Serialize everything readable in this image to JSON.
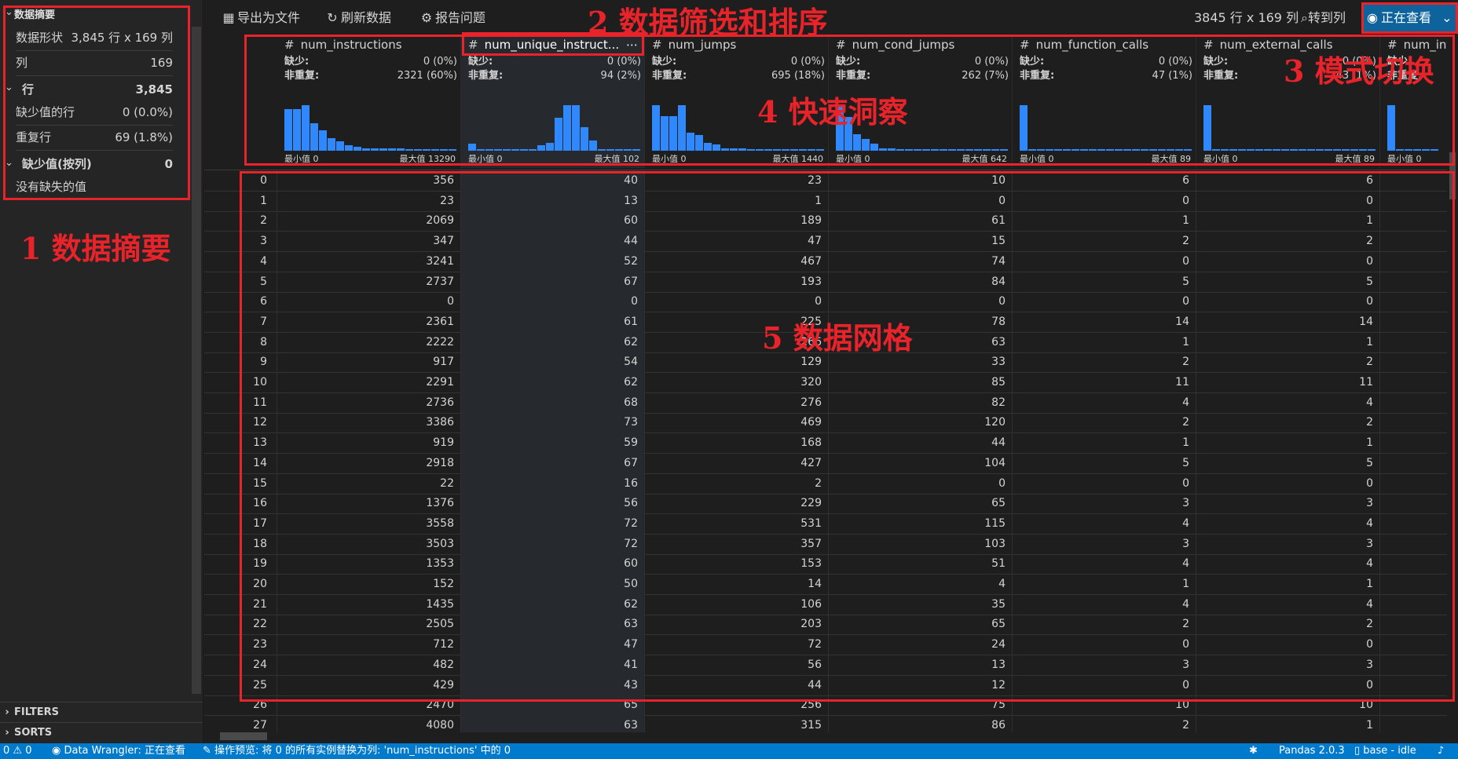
{
  "sidebar": {
    "title": "数据摘要",
    "shape_label": "数据形状",
    "shape_value": "3,845 行 x 169 列",
    "cols_label": "列",
    "cols_value": "169",
    "rows_label": "行",
    "rows_value": "3,845",
    "missing_rows_label": "缺少值的行",
    "missing_rows_value": "0 (0.0%)",
    "dup_rows_label": "重复行",
    "dup_rows_value": "69 (1.8%)",
    "missing_by_col_label": "缺少值(按列)",
    "missing_by_col_value": "0",
    "no_missing_text": "没有缺失的值",
    "filters_label": "FILTERS",
    "sorts_label": "SORTS"
  },
  "toolbar": {
    "export_label": "导出为文件",
    "refresh_label": "刷新数据",
    "report_label": "报告问题",
    "shape_text": "3845 行 x 169 列",
    "goto_label": "转到列",
    "mode_label": "正在查看"
  },
  "header_labels": {
    "missing": "缺少:",
    "distinct": "非重复:",
    "min_prefix": "最小值",
    "max_prefix": "最大值"
  },
  "columns": [
    {
      "name": "num_instructions",
      "missing": "0 (0%)",
      "distinct": "2321 (60%)",
      "min": "0",
      "max": "13290",
      "hist": [
        0.92,
        0.92,
        1.0,
        0.6,
        0.44,
        0.28,
        0.2,
        0.12,
        0.08,
        0.06,
        0.05,
        0.05,
        0.05,
        0.05,
        0.04,
        0.04,
        0.04,
        0.04,
        0.04,
        0.04
      ]
    },
    {
      "name": "num_unique_instruct...",
      "missing": "0 (0%)",
      "distinct": "94 (2%)",
      "min": "0",
      "max": "102",
      "hist": [
        0.16,
        0.04,
        0.04,
        0.04,
        0.04,
        0.04,
        0.04,
        0.04,
        0.12,
        0.18,
        0.72,
        1.0,
        1.0,
        0.52,
        0.22,
        0.04,
        0.04,
        0.04,
        0.04,
        0.04
      ]
    },
    {
      "name": "num_jumps",
      "missing": "0 (0%)",
      "distinct": "695 (18%)",
      "min": "0",
      "max": "1440",
      "hist": [
        1.0,
        0.76,
        0.76,
        1.0,
        0.4,
        0.34,
        0.18,
        0.14,
        0.06,
        0.05,
        0.05,
        0.04,
        0.04,
        0.04,
        0.04,
        0.04,
        0.04,
        0.04,
        0.04,
        0.04
      ]
    },
    {
      "name": "num_cond_jumps",
      "missing": "0 (0%)",
      "distinct": "262 (7%)",
      "min": "0",
      "max": "642",
      "hist": [
        1.0,
        0.74,
        0.36,
        0.26,
        0.16,
        0.06,
        0.05,
        0.04,
        0.04,
        0.04,
        0.04,
        0.04,
        0.04,
        0.04,
        0.04,
        0.04,
        0.04,
        0.04,
        0.04,
        0.04
      ]
    },
    {
      "name": "num_function_calls",
      "missing": "0 (0%)",
      "distinct": "47 (1%)",
      "min": "0",
      "max": "89",
      "hist": [
        1.0,
        0.04,
        0.04,
        0.04,
        0.04,
        0.04,
        0.04,
        0.04,
        0.04,
        0.04,
        0.04,
        0.04,
        0.04,
        0.04,
        0.04,
        0.04,
        0.04,
        0.04,
        0.04,
        0.04
      ]
    },
    {
      "name": "num_external_calls",
      "missing": "0 (0%)",
      "distinct": "43 (1%)",
      "min": "0",
      "max": "89",
      "hist": [
        1.0,
        0.04,
        0.04,
        0.04,
        0.04,
        0.04,
        0.04,
        0.04,
        0.04,
        0.04,
        0.04,
        0.04,
        0.04,
        0.04,
        0.04,
        0.04,
        0.04,
        0.04,
        0.04,
        0.04
      ]
    },
    {
      "name": "num_int",
      "missing": "",
      "distinct": "",
      "min": "0",
      "max": "",
      "hist": [
        1.0,
        0.04,
        0.04,
        0.04,
        0.04,
        0.04
      ]
    }
  ],
  "rows": [
    [
      0,
      356,
      40,
      23,
      10,
      6,
      6
    ],
    [
      1,
      23,
      13,
      1,
      0,
      0,
      0
    ],
    [
      2,
      2069,
      60,
      189,
      61,
      1,
      1
    ],
    [
      3,
      347,
      44,
      47,
      15,
      2,
      2
    ],
    [
      4,
      3241,
      52,
      467,
      74,
      0,
      0
    ],
    [
      5,
      2737,
      67,
      193,
      84,
      5,
      5
    ],
    [
      6,
      0,
      0,
      0,
      0,
      0,
      0
    ],
    [
      7,
      2361,
      61,
      225,
      78,
      14,
      14
    ],
    [
      8,
      2222,
      62,
      266,
      63,
      1,
      1
    ],
    [
      9,
      917,
      54,
      129,
      33,
      2,
      2
    ],
    [
      10,
      2291,
      62,
      320,
      85,
      11,
      11
    ],
    [
      11,
      2736,
      68,
      276,
      82,
      4,
      4
    ],
    [
      12,
      3386,
      73,
      469,
      120,
      2,
      2
    ],
    [
      13,
      919,
      59,
      168,
      44,
      1,
      1
    ],
    [
      14,
      2918,
      67,
      427,
      104,
      5,
      5
    ],
    [
      15,
      22,
      16,
      2,
      0,
      0,
      0
    ],
    [
      16,
      1376,
      56,
      229,
      65,
      3,
      3
    ],
    [
      17,
      3558,
      72,
      531,
      115,
      4,
      4
    ],
    [
      18,
      3503,
      72,
      357,
      103,
      3,
      3
    ],
    [
      19,
      1353,
      60,
      153,
      51,
      4,
      4
    ],
    [
      20,
      152,
      50,
      14,
      4,
      1,
      1
    ],
    [
      21,
      1435,
      62,
      106,
      35,
      4,
      4
    ],
    [
      22,
      2505,
      63,
      203,
      65,
      2,
      2
    ],
    [
      23,
      712,
      47,
      72,
      24,
      0,
      0
    ],
    [
      24,
      482,
      41,
      56,
      13,
      3,
      3
    ],
    [
      25,
      429,
      43,
      44,
      12,
      0,
      0
    ],
    [
      26,
      2470,
      65,
      256,
      75,
      10,
      10
    ],
    [
      27,
      4080,
      63,
      315,
      86,
      2,
      1
    ]
  ],
  "statusbar": {
    "problems": "0 ⚠ 0",
    "wrangler": "Data Wrangler: 正在查看",
    "preview": "操作预览: 将 0 的所有实例替换为列: 'num_instructions' 中的 0",
    "pandas": "Pandas 2.0.3",
    "kernel": "base - idle"
  },
  "annotations": {
    "label1": "1 数据摘要",
    "label2": "2 数据筛选和排序",
    "label3": "3 模式切换",
    "label4": "4 快速洞察",
    "label5": "5 数据网格"
  }
}
